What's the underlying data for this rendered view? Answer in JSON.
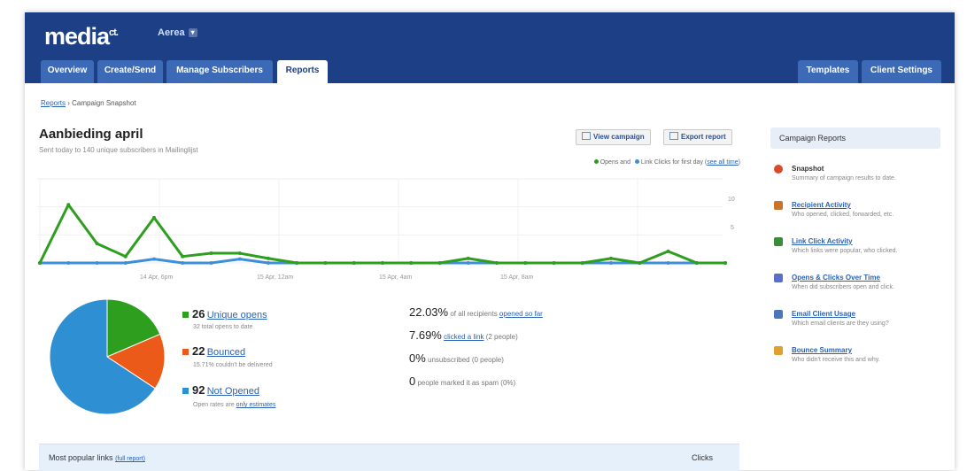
{
  "app": {
    "logo": "media",
    "logo_sup": "ct.",
    "account": "Aerea"
  },
  "nav": {
    "tabs": [
      "Overview",
      "Create/Send",
      "Manage Subscribers",
      "Reports"
    ],
    "right_tabs": [
      "Templates",
      "Client Settings"
    ]
  },
  "breadcrumb": {
    "link": "Reports",
    "sep": "›",
    "current": "Campaign Snapshot"
  },
  "campaign": {
    "title": "Aanbieding april",
    "subtitle": "Sent today to 140 unique subscribers in Mailinglijst"
  },
  "actions": {
    "view": "View campaign",
    "export": "Export report"
  },
  "legend": {
    "opens": "Opens and",
    "clicks": "Link Clicks for first day",
    "see_all_open": "(",
    "see_all": "see all time",
    "see_all_close": ")"
  },
  "chart_data": {
    "type": "line",
    "x_labels": [
      "14 Apr, 6pm",
      "15 Apr, 12am",
      "15 Apr, 4am",
      "15 Apr, 8am"
    ],
    "y_ticks": [
      "10",
      "5"
    ],
    "ylim": [
      0,
      13
    ],
    "series": [
      {
        "name": "Opens",
        "color": "#2e9e1f",
        "values": [
          0,
          9,
          3,
          1,
          7,
          1,
          1.5,
          1.5,
          0.7,
          0,
          0,
          0,
          0,
          0,
          0,
          0.7,
          0,
          0,
          0,
          0,
          0.7,
          0,
          1.8,
          0,
          0
        ]
      },
      {
        "name": "Link Clicks",
        "color": "#3d8fd6",
        "values": [
          0,
          0,
          0,
          0,
          0.6,
          0,
          0,
          0.6,
          0,
          0,
          0,
          0,
          0,
          0,
          0,
          0,
          0,
          0,
          0,
          0,
          0,
          0,
          0,
          0,
          0
        ]
      }
    ]
  },
  "pie": {
    "values": [
      26,
      22,
      92
    ],
    "colors": [
      "#2e9e1f",
      "#ec5a1a",
      "#2f8fd3"
    ]
  },
  "stats": {
    "opens": {
      "num": "26",
      "label": "Unique opens",
      "sub": "32 total opens to date"
    },
    "bounced": {
      "num": "22",
      "label": "Bounced",
      "sub": "15.71% couldn't be delivered"
    },
    "not_opened": {
      "num": "92",
      "label": "Not Opened",
      "sub": "Open rates are",
      "sub_link": "only estimates"
    }
  },
  "percents": {
    "p1": {
      "big": "22.03%",
      "text": "of all recipients",
      "link": "opened so far"
    },
    "p2": {
      "big": "7.69%",
      "link": "clicked a link",
      "text": "(2 people)"
    },
    "p3": {
      "big": "0%",
      "text": "unsubscribed (0 people)"
    },
    "p4": {
      "big": "0",
      "text": "people marked it as spam (0%)"
    }
  },
  "popular_links": {
    "label": "Most popular links",
    "full": "(full report)",
    "clicks": "Clicks"
  },
  "sidebar": {
    "title": "Campaign Reports",
    "items": [
      {
        "title": "Snapshot",
        "desc": "Summary of campaign results to date.",
        "icon": "pie-icon",
        "color": "#d94a2a"
      },
      {
        "title": "Recipient Activity",
        "desc": "Who opened, clicked, forwarded, etc.",
        "icon": "people-icon",
        "color": "#c8742a"
      },
      {
        "title": "Link Click Activity",
        "desc": "Which links were popular, who clicked.",
        "icon": "link-icon",
        "color": "#3c8a3c"
      },
      {
        "title": "Opens & Clicks Over Time",
        "desc": "When did subscribers open and click.",
        "icon": "graph-icon",
        "color": "#5a6fc8"
      },
      {
        "title": "Email Client Usage",
        "desc": "Which email clients are they using?",
        "icon": "client-icon",
        "color": "#4a78b8"
      },
      {
        "title": "Bounce Summary",
        "desc": "Who didn't receive this and why.",
        "icon": "bounce-icon",
        "color": "#e0a030"
      }
    ]
  }
}
